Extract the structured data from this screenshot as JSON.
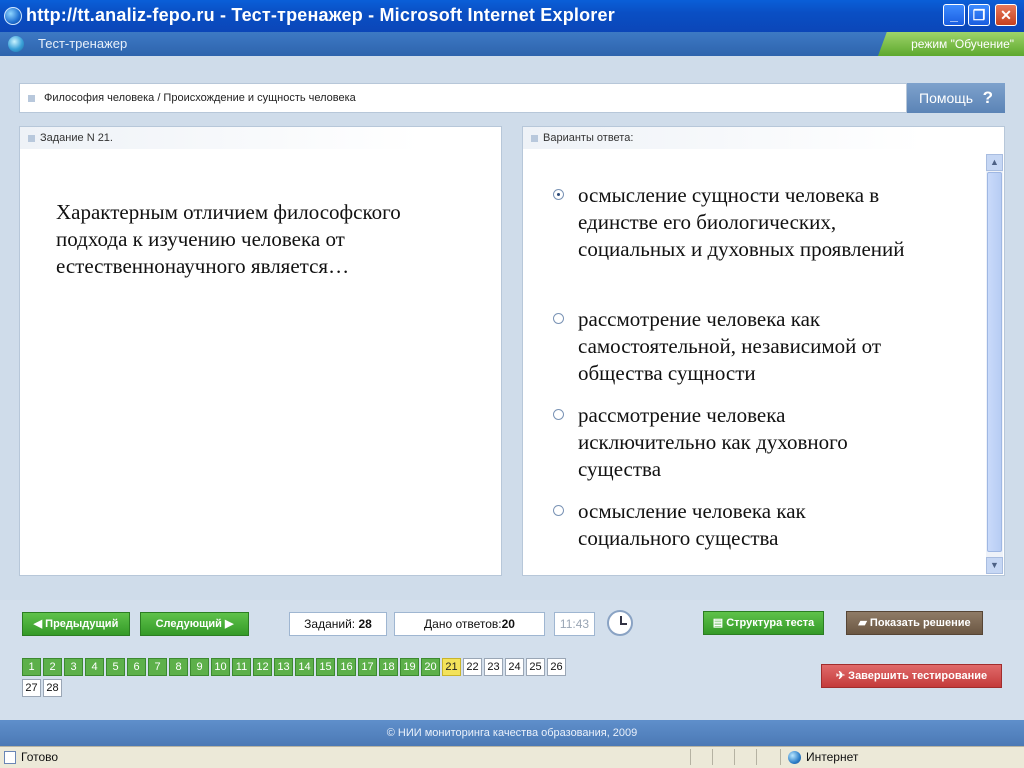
{
  "window": {
    "title": "http://tt.analiz-fepo.ru - Тест-тренажер - Microsoft Internet Explorer",
    "buttons": {
      "minimize": "_",
      "maximize": "❐",
      "close": "✕"
    }
  },
  "app": {
    "title": "Тест-тренажер",
    "mode": "режим \"Обучение\""
  },
  "breadcrumb": "Философия человека / Происхождение и сущность человека",
  "help": {
    "label": "Помощь",
    "icon": "?"
  },
  "question": {
    "header": "Задание N 21.",
    "text": "Характерным отличием философского подхода к изучению человека от естественнонаучного является…"
  },
  "answers": {
    "header": "Варианты ответа:",
    "options": [
      {
        "text": "осмысление сущности человека в единстве его биологических, социальных и духовных проявлений",
        "selected": true
      },
      {
        "text": "рассмотрение человека как самостоятельной, независимой от общества сущности",
        "selected": false
      },
      {
        "text": "рассмотрение человека исключительно как духовного существа",
        "selected": false
      },
      {
        "text": "осмысление человека как социального существа",
        "selected": false
      }
    ]
  },
  "controls": {
    "prev_label": "Предыдущий",
    "next_label": "Следующий",
    "tasks_label": "Заданий:",
    "tasks_value": "28",
    "answered_label": "Дано ответов:",
    "answered_value": "20",
    "timer": "11:43",
    "structure_label": "Структура теста",
    "solution_label": "Показать решение",
    "finish_label": "Завершить тестирование"
  },
  "question_numbers": {
    "done": [
      "1",
      "2",
      "3",
      "4",
      "5",
      "6",
      "7",
      "8",
      "9",
      "10",
      "11",
      "12",
      "13",
      "14",
      "15",
      "16",
      "17",
      "18",
      "19",
      "20"
    ],
    "current": "21",
    "todo": [
      "22",
      "23",
      "24",
      "25",
      "26",
      "27",
      "28"
    ]
  },
  "footer": "© НИИ мониторинга качества образования, 2009",
  "statusbar": {
    "status": "Готово",
    "zone": "Интернет"
  },
  "colors": {
    "done": "#5db04a",
    "current": "#f3e25a",
    "title_bar": "#0a4fc4",
    "finish_button": "#c43b3b"
  }
}
